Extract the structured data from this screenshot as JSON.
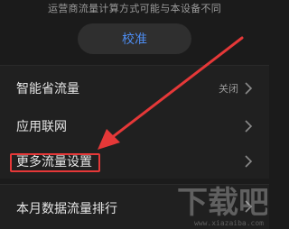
{
  "header": {
    "note": "运营商流量计算方式可能与本设备不同",
    "calibrate_label": "校准"
  },
  "settings": {
    "rows": [
      {
        "label": "智能省流量",
        "value": "关闭"
      },
      {
        "label": "应用联网"
      },
      {
        "label": "更多流量设置"
      }
    ]
  },
  "bottom": {
    "label": "本月数据流量排行"
  },
  "watermark": {
    "text": "下载吧",
    "site": "www.xiazaiba.com"
  },
  "colors": {
    "accent": "#4d8cf0",
    "highlight": "#e53838",
    "background": "#1b1b1b"
  }
}
